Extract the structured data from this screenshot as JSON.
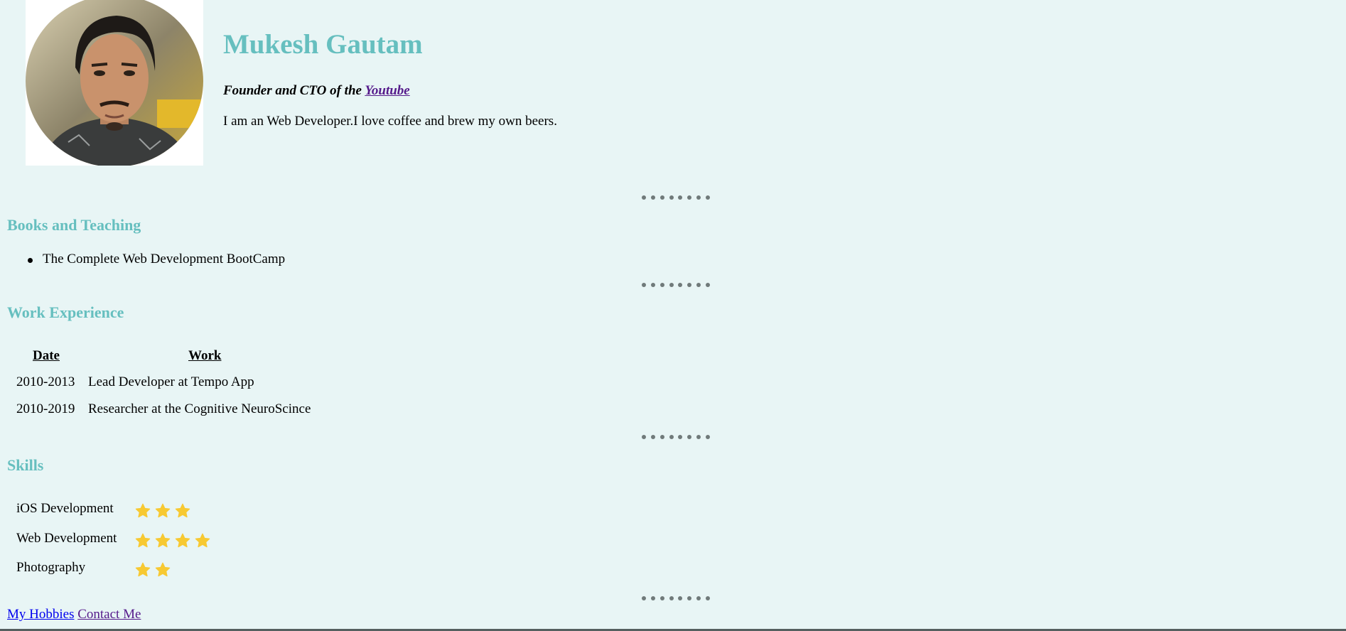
{
  "profile": {
    "name": "Mukesh Gautam",
    "tagline_prefix": "Founder and CTO of the ",
    "tagline_link": "Youtube",
    "bio": "I am an Web Developer.I love coffee and brew my own beers."
  },
  "books": {
    "title": "Books and Teaching",
    "items": [
      "The Complete Web Development BootCamp"
    ]
  },
  "work": {
    "title": "Work Experience",
    "headers": [
      "Date",
      "Work"
    ],
    "rows": [
      [
        "2010-2013",
        "Lead Developer at Tempo App"
      ],
      [
        "2010-2019",
        "Researcher at the Cognitive NeuroScince"
      ]
    ]
  },
  "skills": {
    "title": "Skills",
    "items": [
      {
        "name": "iOS Development",
        "stars": 3
      },
      {
        "name": "Web Development",
        "stars": 4
      },
      {
        "name": "Photography",
        "stars": 2
      }
    ]
  },
  "footer": {
    "links": [
      "My Hobbies",
      "Contact Me"
    ]
  },
  "colors": {
    "background": "#e8f5f5",
    "heading": "#66bfbf",
    "star": "#f7c932",
    "visited_link": "#551a8b",
    "link": "#0000ee"
  },
  "icons": {
    "star": "star-icon",
    "divider": "dots-divider"
  }
}
